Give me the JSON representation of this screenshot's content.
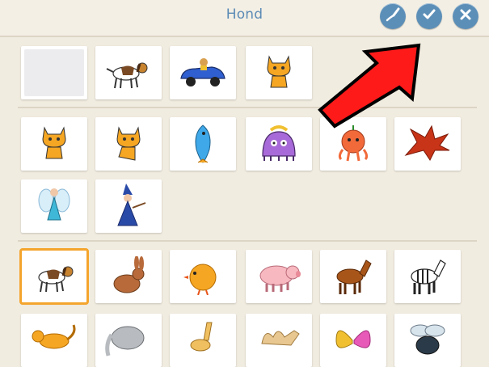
{
  "header": {
    "title": "Hond"
  },
  "buttons": {
    "paint_icon": "paint-editor-icon",
    "ok_icon": "checkmark-icon",
    "cancel_icon": "close-icon"
  },
  "sections": [
    {
      "name": "user-sprites",
      "items": [
        "",
        "dog",
        "car",
        "cat"
      ]
    },
    {
      "name": "sample-sprites",
      "items": [
        "cat",
        "cat",
        "fish",
        "monster",
        "octopus",
        "dragon",
        "fairy",
        "wizard"
      ]
    },
    {
      "name": "animals",
      "items": [
        "dog",
        "rabbit",
        "chick",
        "pig",
        "horse",
        "zebra",
        "monkey",
        "elephant",
        "giraffe",
        "camel",
        "butterfly",
        "fly"
      ],
      "selected_index": 0
    }
  ],
  "colors": {
    "accent_blue": "#5c8fb8",
    "selection": "#f4a52d",
    "arrow_red": "#ff1a1a"
  }
}
